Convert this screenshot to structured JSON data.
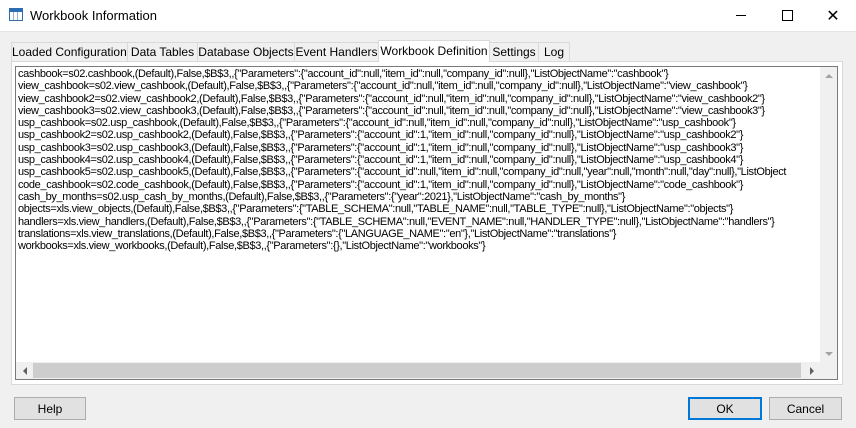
{
  "window": {
    "title": "Workbook Information",
    "icon": "spreadsheet-icon",
    "minimize_glyph": "minimize-icon",
    "maximize_glyph": "maximize-icon",
    "close_glyph": "✕"
  },
  "tabs": [
    {
      "label": "Loaded Configurations",
      "active": false
    },
    {
      "label": "Data Tables",
      "active": false
    },
    {
      "label": "Database Objects",
      "active": false
    },
    {
      "label": "Event Handlers",
      "active": false
    },
    {
      "label": "Workbook Definition",
      "active": true
    },
    {
      "label": "Settings",
      "active": false
    },
    {
      "label": "Log",
      "active": false
    }
  ],
  "definition_lines": [
    "cashbook=s02.cashbook,(Default),False,$B$3,,{\"Parameters\":{\"account_id\":null,\"item_id\":null,\"company_id\":null},\"ListObjectName\":\"cashbook\"}",
    "view_cashbook=s02.view_cashbook,(Default),False,$B$3,,{\"Parameters\":{\"account_id\":null,\"item_id\":null,\"company_id\":null},\"ListObjectName\":\"view_cashbook\"}",
    "view_cashbook2=s02.view_cashbook2,(Default),False,$B$3,,{\"Parameters\":{\"account_id\":null,\"item_id\":null,\"company_id\":null},\"ListObjectName\":\"view_cashbook2\"}",
    "view_cashbook3=s02.view_cashbook3,(Default),False,$B$3,,{\"Parameters\":{\"account_id\":null,\"item_id\":null,\"company_id\":null},\"ListObjectName\":\"view_cashbook3\"}",
    "usp_cashbook=s02.usp_cashbook,(Default),False,$B$3,,{\"Parameters\":{\"account_id\":null,\"item_id\":null,\"company_id\":null},\"ListObjectName\":\"usp_cashbook\"}",
    "usp_cashbook2=s02.usp_cashbook2,(Default),False,$B$3,,{\"Parameters\":{\"account_id\":1,\"item_id\":null,\"company_id\":null},\"ListObjectName\":\"usp_cashbook2\"}",
    "usp_cashbook3=s02.usp_cashbook3,(Default),False,$B$3,,{\"Parameters\":{\"account_id\":1,\"item_id\":null,\"company_id\":null},\"ListObjectName\":\"usp_cashbook3\"}",
    "usp_cashbook4=s02.usp_cashbook4,(Default),False,$B$3,,{\"Parameters\":{\"account_id\":1,\"item_id\":null,\"company_id\":null},\"ListObjectName\":\"usp_cashbook4\"}",
    "usp_cashbook5=s02.usp_cashbook5,(Default),False,$B$3,,{\"Parameters\":{\"account_id\":null,\"item_id\":null,\"company_id\":null,\"year\":null,\"month\":null,\"day\":null},\"ListObject",
    "code_cashbook=s02.code_cashbook,(Default),False,$B$3,,{\"Parameters\":{\"account_id\":1,\"item_id\":null,\"company_id\":null},\"ListObjectName\":\"code_cashbook\"}",
    "cash_by_months=s02.usp_cash_by_months,(Default),False,$B$3,,{\"Parameters\":{\"year\":2021},\"ListObjectName\":\"cash_by_months\"}",
    "objects=xls.view_objects,(Default),False,$B$3,,{\"Parameters\":{\"TABLE_SCHEMA\":null,\"TABLE_NAME\":null,\"TABLE_TYPE\":null},\"ListObjectName\":\"objects\"}",
    "handlers=xls.view_handlers,(Default),False,$B$3,,{\"Parameters\":{\"TABLE_SCHEMA\":null,\"EVENT_NAME\":null,\"HANDLER_TYPE\":null},\"ListObjectName\":\"handlers\"}",
    "translations=xls.view_translations,(Default),False,$B$3,,{\"Parameters\":{\"LANGUAGE_NAME\":\"en\"},\"ListObjectName\":\"translations\"}",
    "workbooks=xls.view_workbooks,(Default),False,$B$3,,{\"Parameters\":{},\"ListObjectName\":\"workbooks\"}"
  ],
  "buttons": {
    "help": "Help",
    "ok": "OK",
    "cancel": "Cancel"
  },
  "colors": {
    "accent": "#0078d7",
    "window_bg": "#f0f0f0"
  }
}
